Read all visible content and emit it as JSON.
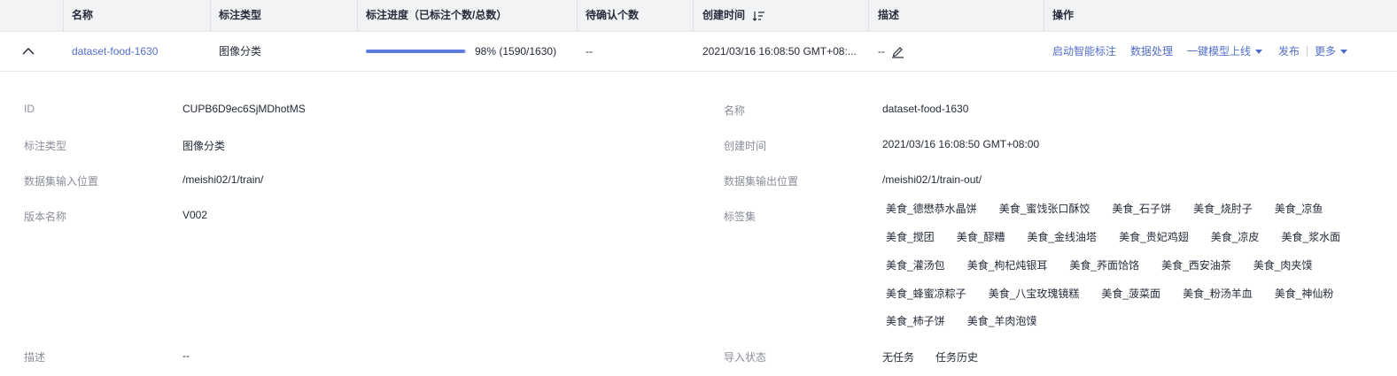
{
  "table": {
    "headers": {
      "name": "名称",
      "type": "标注类型",
      "progress": "标注进度（已标注个数/总数）",
      "pending": "待确认个数",
      "created": "创建时间",
      "description": "描述",
      "actions": "操作"
    },
    "row": {
      "name": "dataset-food-1630",
      "type": "图像分类",
      "progress_fraction": 0.98,
      "progress_text": "98% (1590/1630)",
      "pending": "--",
      "created": "2021/03/16 16:08:50 GMT+08:...",
      "description": "--",
      "actions": {
        "auto_label": "启动智能标注",
        "data_processing": "数据处理",
        "one_click_deploy": "一键模型上线",
        "publish": "发布",
        "more": "更多"
      }
    }
  },
  "details": {
    "left": [
      {
        "label": "ID",
        "value": "CUPB6D9ec6SjMDhotMS"
      },
      {
        "label": "标注类型",
        "value": "图像分类"
      },
      {
        "label": "数据集输入位置",
        "value": "/meishi02/1/train/"
      },
      {
        "label": "版本名称",
        "value": "V002"
      },
      {
        "label": "描述",
        "value": "--"
      }
    ],
    "right": [
      {
        "label": "名称",
        "value": "dataset-food-1630"
      },
      {
        "label": "创建时间",
        "value": "2021/03/16 16:08:50 GMT+08:00"
      },
      {
        "label": "数据集输出位置",
        "value": "/meishi02/1/train-out/"
      },
      {
        "label": "标签集"
      },
      {
        "label": "导入状态",
        "value": "无任务",
        "link": "任务历史"
      }
    ],
    "tags": [
      [
        "美食_德懋恭水晶饼",
        "美食_蜜饯张口酥饺",
        "美食_石子饼",
        "美食_烧肘子",
        "美食_凉鱼"
      ],
      [
        "美食_搅团",
        "美食_醪糟",
        "美食_金线油塔",
        "美食_贵妃鸡翅",
        "美食_凉皮",
        "美食_浆水面"
      ],
      [
        "美食_灌汤包",
        "美食_枸杞炖银耳",
        "美食_荞面饸饹",
        "美食_西安油茶",
        "美食_肉夹馍"
      ],
      [
        "美食_蜂蜜凉粽子",
        "美食_八宝玫瑰镜糕",
        "美食_菠菜面",
        "美食_粉汤羊血",
        "美食_神仙粉"
      ],
      [
        "美食_柿子饼",
        "美食_羊肉泡馍"
      ]
    ]
  },
  "colors": {
    "link": "#526ecc",
    "progress": "#5e7ce0",
    "header_bg": "#f2f3f5",
    "label": "#8a8e99"
  }
}
